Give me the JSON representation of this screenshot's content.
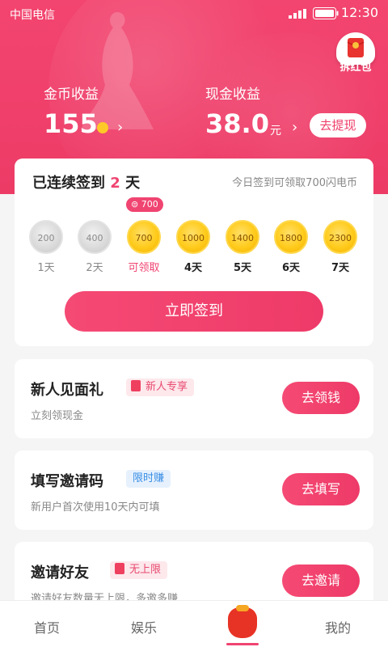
{
  "status_bar": {
    "carrier": "中国电信",
    "time": "12:30"
  },
  "header": {
    "red_packet_label": "拆红包",
    "coin_earnings": {
      "label": "金币收益",
      "value": "155"
    },
    "cash_earnings": {
      "label": "现金收益",
      "value": "38.0",
      "unit": "元"
    },
    "withdraw_button": "去提现"
  },
  "signin": {
    "title_prefix": "已连续签到",
    "streak_days": "2",
    "title_suffix": "天",
    "hint": "今日签到可领取700闪电币",
    "bubble": "700",
    "days": [
      {
        "coin": "200",
        "label": "1天",
        "state": "claimed"
      },
      {
        "coin": "400",
        "label": "2天",
        "state": "claimed"
      },
      {
        "coin": "700",
        "label": "可领取",
        "state": "today"
      },
      {
        "coin": "1000",
        "label": "4天",
        "state": "future"
      },
      {
        "coin": "1400",
        "label": "5天",
        "state": "future"
      },
      {
        "coin": "1800",
        "label": "6天",
        "state": "future"
      },
      {
        "coin": "2300",
        "label": "7天",
        "state": "future"
      }
    ],
    "button": "立即签到"
  },
  "tasks": [
    {
      "title": "新人见面礼",
      "tag": "新人专享",
      "tag_style": "red",
      "subtitle": "立刻领现金",
      "button": "去领钱"
    },
    {
      "title": "填写邀请码",
      "tag": "限时赚",
      "tag_style": "blue",
      "subtitle": "新用户首次使用10天内可填",
      "button": "去填写"
    },
    {
      "title": "邀请好友",
      "tag": "无上限",
      "tag_style": "red",
      "subtitle": "邀请好友数量无上限，多邀多赚",
      "button": "去邀请"
    }
  ],
  "tabbar": {
    "items": [
      "首页",
      "娱乐",
      "我的"
    ],
    "active_center_icon": "lucky-bag-icon"
  },
  "colors": {
    "primary": "#ef3f6a",
    "coin_gold": "#ffcb1c",
    "tag_blue": "#3a8ee6"
  }
}
